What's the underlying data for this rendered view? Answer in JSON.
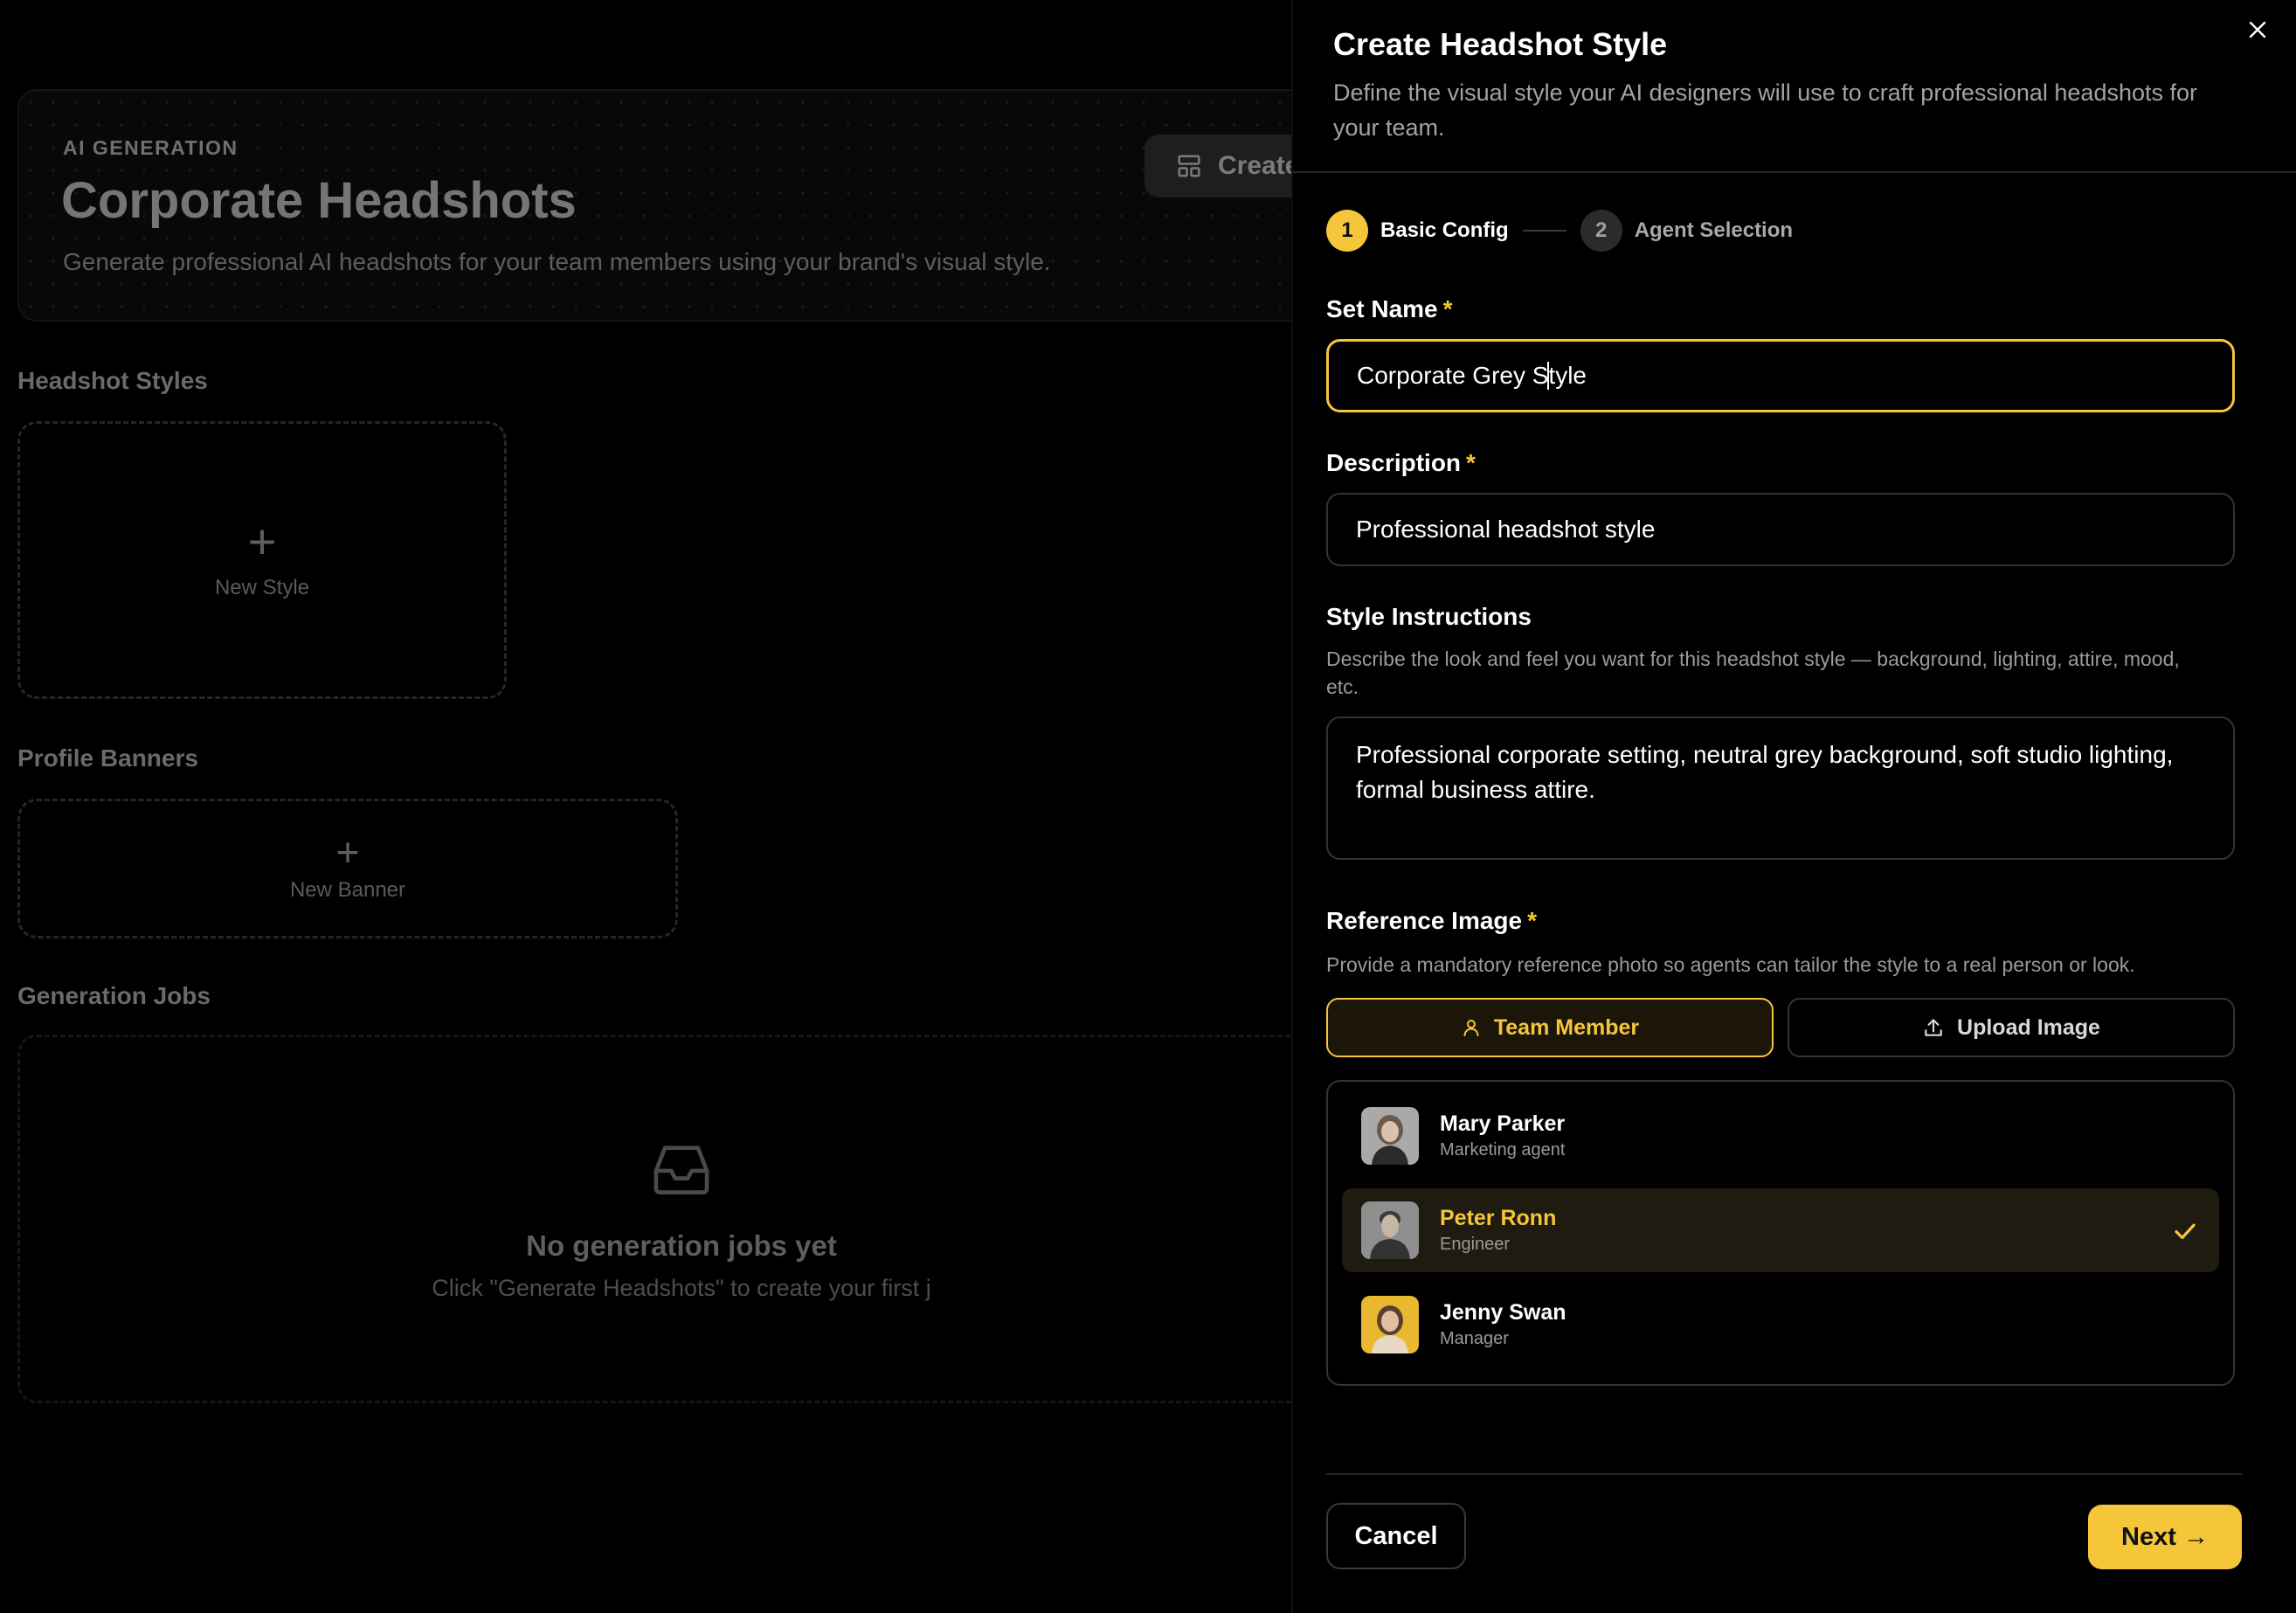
{
  "background": {
    "hero": {
      "eyebrow": "AI GENERATION",
      "title": "Corporate Headshots",
      "subtitle": "Generate professional AI headshots for your team members using your brand's visual style.",
      "create_button": "Create"
    },
    "sections": {
      "headshot_styles": "Headshot Styles",
      "new_style": "New Style",
      "profile_banners": "Profile Banners",
      "new_banner": "New Banner",
      "generation_jobs": "Generation Jobs"
    },
    "empty_state": {
      "title": "No generation jobs yet",
      "subtitle": "Click \"Generate Headshots\" to create your first j"
    }
  },
  "drawer": {
    "title": "Create Headshot Style",
    "subtitle": "Define the visual style your AI designers will use to craft professional headshots for your team.",
    "steps": [
      {
        "number": "1",
        "label": "Basic Config",
        "active": true
      },
      {
        "number": "2",
        "label": "Agent Selection",
        "active": false
      }
    ],
    "set_name": {
      "label": "Set Name",
      "required_mark": "*",
      "value_before_caret": "Corporate Grey S",
      "value_after_caret": "tyle"
    },
    "description": {
      "label": "Description",
      "required_mark": "*",
      "value": "Professional headshot style"
    },
    "style_instructions": {
      "label": "Style Instructions",
      "help": "Describe the look and feel you want for this headshot style — background, lighting, attire, mood, etc.",
      "value": "Professional corporate setting, neutral grey background, soft studio lighting, formal business attire."
    },
    "reference_image": {
      "label": "Reference Image",
      "required_mark": "*",
      "help": "Provide a mandatory reference photo so agents can tailor the style to a real person or look.",
      "toggle_team": "Team Member",
      "toggle_upload": "Upload Image",
      "members": [
        {
          "name": "Mary Parker",
          "role": "Marketing agent",
          "selected": false
        },
        {
          "name": "Peter Ronn",
          "role": "Engineer",
          "selected": true
        },
        {
          "name": "Jenny Swan",
          "role": "Manager",
          "selected": false
        }
      ]
    },
    "footer": {
      "cancel": "Cancel",
      "next": "Next →"
    }
  },
  "colors": {
    "accent": "#f5c53a",
    "background": "#000000",
    "selected_row": "#1f1b10"
  }
}
